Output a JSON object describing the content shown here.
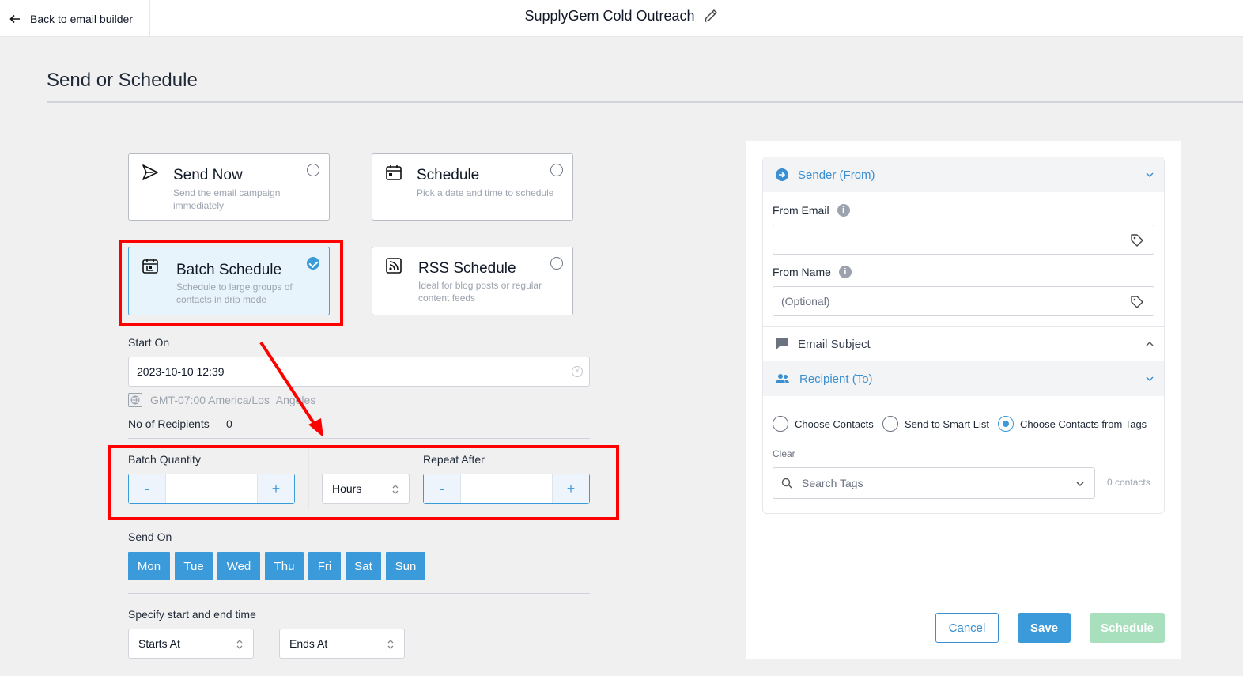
{
  "topbar": {
    "back_label": "Back to email builder",
    "campaign_name": "SupplyGem Cold Outreach"
  },
  "page": {
    "title": "Send or Schedule"
  },
  "options": {
    "send_now": {
      "title": "Send Now",
      "desc": "Send the email campaign immediately",
      "selected": false
    },
    "schedule": {
      "title": "Schedule",
      "desc": "Pick a date and time to schedule",
      "selected": false
    },
    "batch": {
      "title": "Batch Schedule",
      "desc": "Schedule to large groups of contacts in drip mode",
      "selected": true
    },
    "rss": {
      "title": "RSS Schedule",
      "desc": "Ideal for blog posts or regular content feeds",
      "selected": false
    }
  },
  "start_on": {
    "label": "Start On",
    "value": "2023-10-10 12:39",
    "timezone": "GMT-07:00 America/Los_Angeles"
  },
  "recipients": {
    "label": "No of Recipients",
    "count": "0"
  },
  "batch": {
    "quantity_label": "Batch Quantity",
    "minus": "-",
    "plus": "+",
    "unit": "Hours",
    "repeat_label": "Repeat After"
  },
  "send_on": {
    "label": "Send On",
    "days": [
      "Mon",
      "Tue",
      "Wed",
      "Thu",
      "Fri",
      "Sat",
      "Sun"
    ]
  },
  "time_range": {
    "label": "Specify start and end time",
    "start_placeholder": "Starts At",
    "end_placeholder": "Ends At"
  },
  "sender": {
    "title": "Sender (From)",
    "from_email_label": "From Email",
    "from_email_value": "",
    "from_name_label": "From Name",
    "from_name_placeholder": "(Optional)"
  },
  "subject": {
    "title": "Email Subject"
  },
  "recipient": {
    "title": "Recipient (To)",
    "choices": [
      "Choose Contacts",
      "Send to Smart List",
      "Choose Contacts from Tags"
    ],
    "selected_index": 2,
    "clear_label": "Clear",
    "search_placeholder": "Search Tags",
    "contacts_count": "0 contacts"
  },
  "actions": {
    "cancel": "Cancel",
    "save": "Save",
    "schedule": "Schedule"
  },
  "colors": {
    "accent": "#3b9ad9",
    "annotation": "#ff0000",
    "disabled_green": "#a8e0bd"
  },
  "icons": [
    "arrow-left-icon",
    "pencil-icon",
    "send-icon",
    "calendar-icon",
    "batch-calendar-icon",
    "rss-icon",
    "globe-icon",
    "updown-icon",
    "chevron-down-icon",
    "chevron-up-icon",
    "arrow-circle-icon",
    "comment-icon",
    "users-icon",
    "info-icon",
    "tag-icon",
    "search-icon"
  ]
}
